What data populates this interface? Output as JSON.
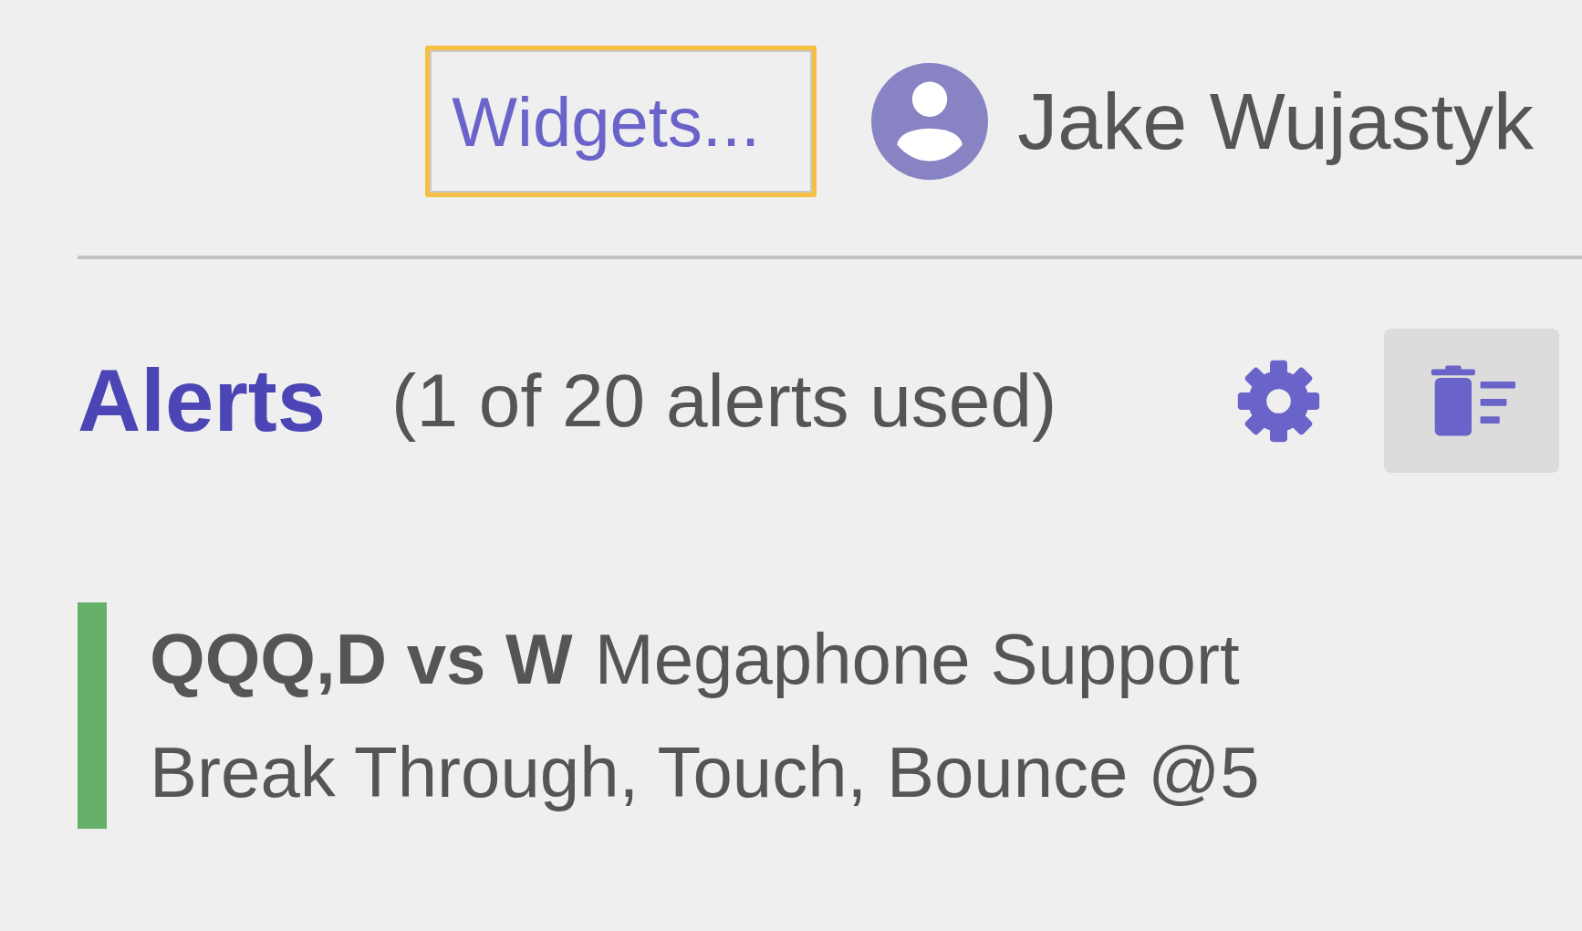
{
  "header": {
    "widgets_button": {
      "label": "Widgets...",
      "focused": true
    },
    "user": {
      "name": "Jake Wujastyk"
    }
  },
  "alerts": {
    "title": "Alerts",
    "usage": "(1 of 20 alerts used)",
    "items": [
      {
        "symbol": "QQQ,D vs W",
        "name": "Megaphone Support",
        "conditions": "Break Through, Touch, Bounce @5",
        "color": "#66b06a"
      }
    ]
  }
}
